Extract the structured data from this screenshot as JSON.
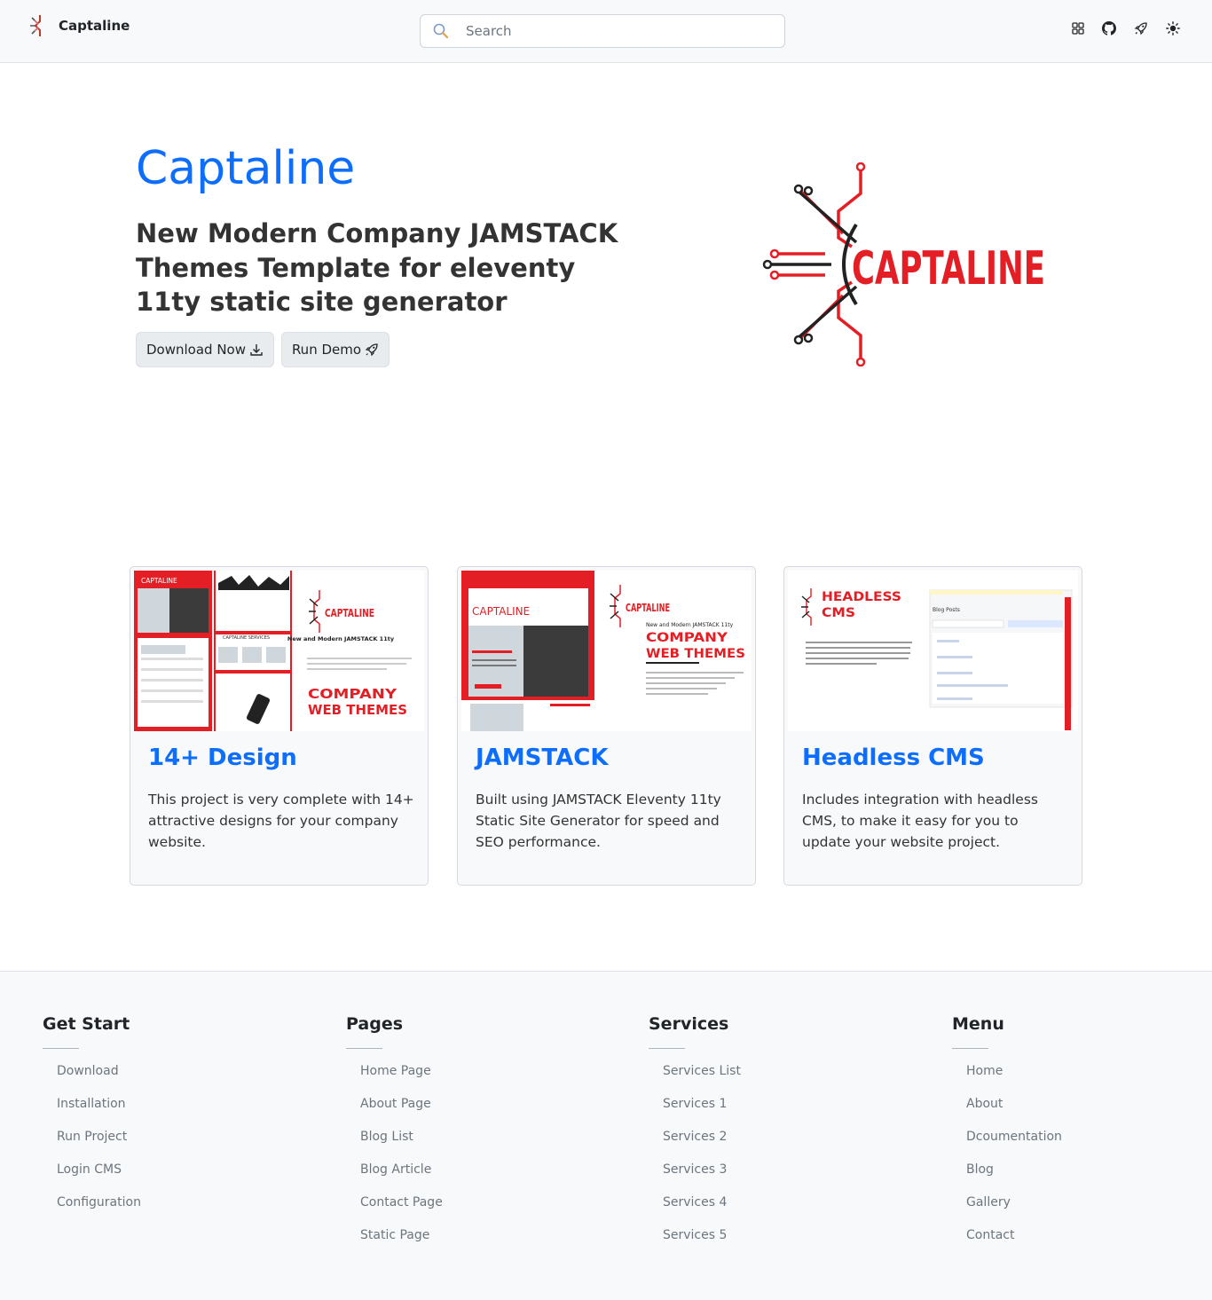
{
  "header": {
    "brand_name": "Captaline",
    "search_placeholder": "Search",
    "icons": [
      "grid-icon",
      "github-icon",
      "rocket-icon",
      "sun-icon"
    ]
  },
  "hero": {
    "title": "Captaline",
    "subtitle": "New Modern Company JAMSTACK Themes Template for eleventy 11ty static site generator",
    "download_label": "Download Now",
    "demo_label": "Run Demo",
    "logo_text": "CAPTALINE"
  },
  "colors": {
    "accent": "#0d6efd",
    "brand_red": "#e31e24"
  },
  "cards": [
    {
      "title": "14+ Design",
      "text": "This project is very complete with 14+ attractive designs for your company website.",
      "img": {
        "brand": "CAPTALINE",
        "heading": "COMPANY WEB THEMES",
        "caption": "New and Modern JAMSTACK 11ty",
        "services": "CAPTALINE SERVICES"
      }
    },
    {
      "title": "JAMSTACK",
      "text": "Built using JAMSTACK Eleventy 11ty Static Site Generator for speed and SEO performance.",
      "img": {
        "brand": "CAPTALINE",
        "heading": "COMPANY WEB THEMES",
        "caption": "New and Modern JAMSTACK 11ty"
      }
    },
    {
      "title": "Headless CMS",
      "text": "Includes integration with headless CMS, to make it easy for you to update your website project.",
      "img": {
        "heading": "HEADLESS CMS",
        "panel": "Blog Posts"
      }
    }
  ],
  "footer": {
    "columns": [
      {
        "heading": "Get Start",
        "items": [
          "Download",
          "Installation",
          "Run Project",
          "Login CMS",
          "Configuration"
        ]
      },
      {
        "heading": "Pages",
        "items": [
          "Home Page",
          "About Page",
          "Blog List",
          "Blog Article",
          "Contact Page",
          "Static Page"
        ]
      },
      {
        "heading": "Services",
        "items": [
          "Services List",
          "Services 1",
          "Services 2",
          "Services 3",
          "Services 4",
          "Services 5"
        ]
      },
      {
        "heading": "Menu",
        "items": [
          "Home",
          "About",
          "Dcoumentation",
          "Blog",
          "Gallery",
          "Contact"
        ]
      }
    ]
  }
}
